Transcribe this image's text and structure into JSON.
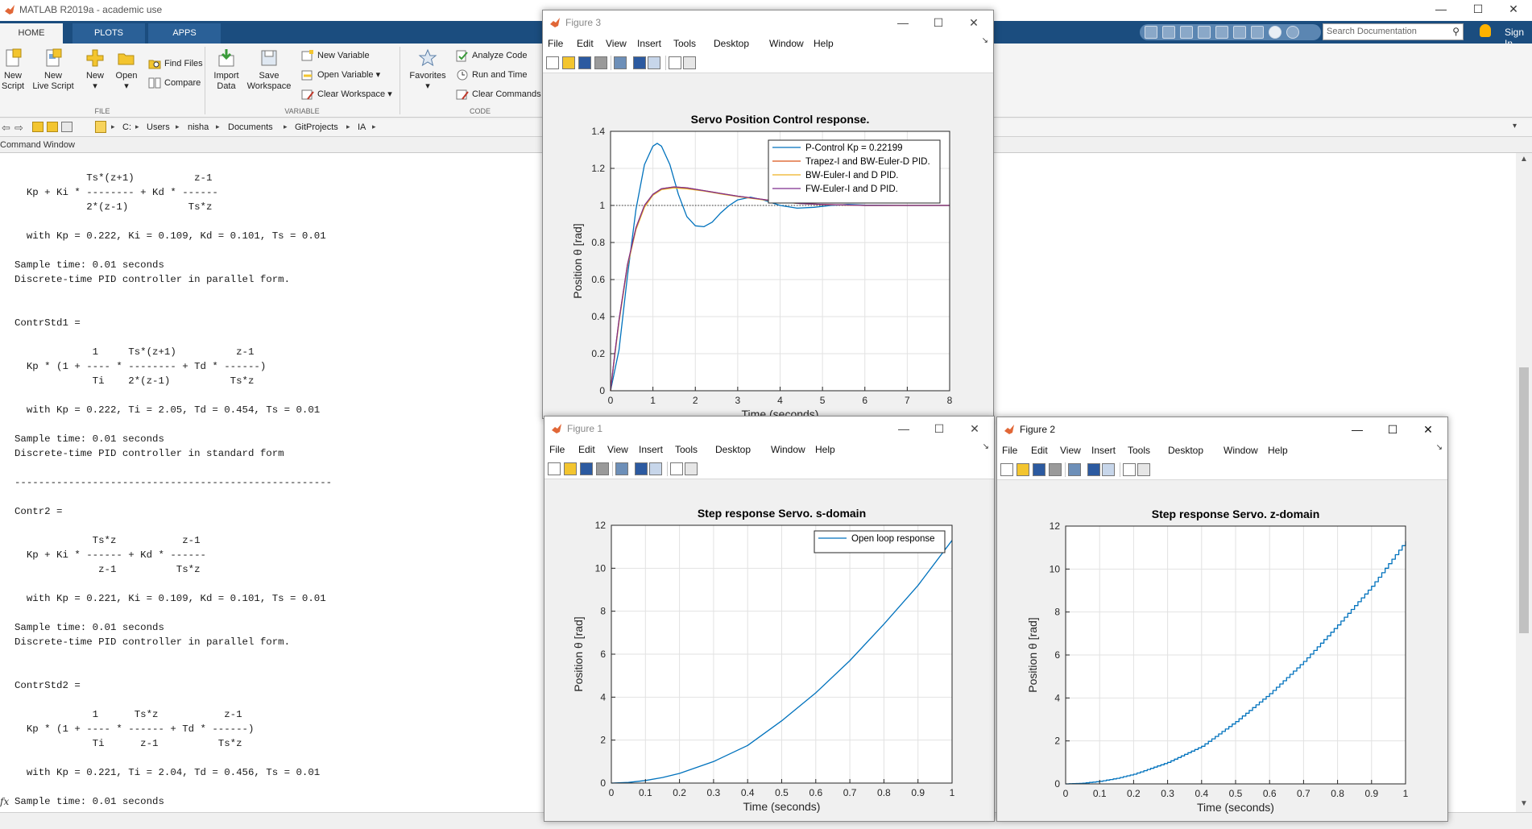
{
  "window": {
    "title": "MATLAB R2019a - academic use",
    "minimize": "—",
    "maximize": "☐",
    "close": "✕"
  },
  "tabs": [
    "HOME",
    "PLOTS",
    "APPS"
  ],
  "search": {
    "placeholder": "Search Documentation"
  },
  "signin": "Sign In",
  "ribbon": {
    "new_script": [
      "New",
      "Script"
    ],
    "new_live_script": [
      "New",
      "Live Script"
    ],
    "new": "New",
    "open": "Open",
    "find_files": "Find Files",
    "compare": "Compare",
    "import_data": [
      "Import",
      "Data"
    ],
    "save_workspace": [
      "Save",
      "Workspace"
    ],
    "new_variable": "New Variable",
    "open_variable": "Open Variable",
    "clear_workspace": "Clear Workspace",
    "favorites": "Favorites",
    "analyze_code": "Analyze Code",
    "run_and_time": "Run and Time",
    "clear_commands": "Clear Commands",
    "sections": [
      "FILE",
      "VARIABLE",
      "CODE"
    ]
  },
  "path": [
    "C:",
    "Users",
    "nisha",
    "Documents",
    "GitProjects",
    "IA"
  ],
  "command_window": {
    "title": "Command Window",
    "prompt_icon": "fx",
    "lines": [
      "            Ts*(z+1)          z-1",
      "  Kp + Ki * -------- + Kd * ------",
      "            2*(z-1)          Ts*z",
      "",
      "  with Kp = 0.222, Ki = 0.109, Kd = 0.101, Ts = 0.01",
      "",
      "Sample time: 0.01 seconds",
      "Discrete-time PID controller in parallel form.",
      "",
      "",
      "ContrStd1 =",
      "",
      "             1     Ts*(z+1)          z-1",
      "  Kp * (1 + ---- * -------- + Td * ------)",
      "             Ti    2*(z-1)          Ts*z",
      "",
      "  with Kp = 0.222, Ti = 2.05, Td = 0.454, Ts = 0.01",
      "",
      "Sample time: 0.01 seconds",
      "Discrete-time PID controller in standard form",
      "",
      "-----------------------------------------------------",
      "",
      "Contr2 =",
      "",
      "             Ts*z           z-1",
      "  Kp + Ki * ------ + Kd * ------",
      "              z-1          Ts*z",
      "",
      "  with Kp = 0.221, Ki = 0.109, Kd = 0.101, Ts = 0.01",
      "",
      "Sample time: 0.01 seconds",
      "Discrete-time PID controller in parallel form.",
      "",
      "",
      "ContrStd2 =",
      "",
      "             1      Ts*z           z-1",
      "  Kp * (1 + ---- * ------ + Td * ------)",
      "             Ti      z-1          Ts*z",
      "",
      "  with Kp = 0.221, Ti = 2.04, Td = 0.456, Ts = 0.01",
      "",
      "Sample time: 0.01 seconds"
    ]
  },
  "figure_menu": [
    "File",
    "Edit",
    "View",
    "Insert",
    "Tools",
    "Desktop",
    "Window",
    "Help"
  ],
  "figures": [
    {
      "id": "fig3",
      "title": "Figure 3",
      "title_active": false
    },
    {
      "id": "fig1",
      "title": "Figure 1",
      "title_active": false
    },
    {
      "id": "fig2",
      "title": "Figure 2",
      "title_active": true
    }
  ],
  "chart_data": [
    {
      "figure": "Figure 3",
      "type": "line",
      "title": "Servo Position Control response.",
      "xlabel": "Time (seconds)",
      "ylabel": "Position θ [rad]",
      "xlim": [
        0,
        8
      ],
      "ylim": [
        0,
        1.4
      ],
      "xticks": [
        0,
        1,
        2,
        3,
        4,
        5,
        6,
        7,
        8
      ],
      "yticks": [
        0,
        0.2,
        0.4,
        0.6,
        0.8,
        1,
        1.2,
        1.4
      ],
      "grid": true,
      "legend_position": "top-right",
      "reference_line": {
        "y": 1,
        "style": "dotted",
        "color": "#333333"
      },
      "series": [
        {
          "name": "P-Control Kp = 0.22199",
          "color": "#0072bd",
          "x": [
            0,
            0.2,
            0.4,
            0.6,
            0.8,
            1.0,
            1.1,
            1.2,
            1.4,
            1.6,
            1.8,
            2.0,
            2.2,
            2.4,
            2.6,
            2.8,
            3.0,
            3.3,
            3.6,
            4.0,
            4.4,
            4.8,
            5.2,
            5.6,
            6.0,
            7.0,
            8.0
          ],
          "y": [
            0,
            0.22,
            0.62,
            0.98,
            1.22,
            1.32,
            1.335,
            1.32,
            1.22,
            1.06,
            0.94,
            0.89,
            0.885,
            0.91,
            0.96,
            1.0,
            1.03,
            1.045,
            1.03,
            1.0,
            0.985,
            0.99,
            1.0,
            1.005,
            1.002,
            1.0,
            1.0
          ]
        },
        {
          "name": "Trapez-I and BW-Euler-D PID.",
          "color": "#d95319",
          "x": [
            0,
            0.1,
            0.2,
            0.4,
            0.6,
            0.8,
            1.0,
            1.2,
            1.5,
            1.8,
            2.2,
            2.6,
            3.0,
            3.5,
            4.0,
            4.5,
            5.0,
            6.0,
            7.0,
            8.0
          ],
          "y": [
            0,
            0.2,
            0.38,
            0.68,
            0.88,
            1.0,
            1.06,
            1.09,
            1.1,
            1.095,
            1.08,
            1.065,
            1.05,
            1.035,
            1.02,
            1.01,
            1.005,
            1.0,
            1.0,
            1.0
          ]
        },
        {
          "name": "BW-Euler-I and D PID.",
          "color": "#edb120",
          "x": [
            0,
            0.1,
            0.2,
            0.4,
            0.6,
            0.8,
            1.0,
            1.2,
            1.5,
            1.8,
            2.2,
            2.6,
            3.0,
            3.5,
            4.0,
            4.5,
            5.0,
            6.0,
            7.0,
            8.0
          ],
          "y": [
            0,
            0.19,
            0.37,
            0.67,
            0.87,
            0.99,
            1.055,
            1.085,
            1.095,
            1.09,
            1.078,
            1.062,
            1.048,
            1.033,
            1.019,
            1.01,
            1.004,
            1.0,
            1.0,
            1.0
          ]
        },
        {
          "name": "FW-Euler-I and D PID.",
          "color": "#7e2f8e",
          "x": [
            0,
            0.1,
            0.2,
            0.4,
            0.6,
            0.8,
            1.0,
            1.2,
            1.5,
            1.8,
            2.2,
            2.6,
            3.0,
            3.5,
            4.0,
            4.5,
            5.0,
            6.0,
            7.0,
            8.0
          ],
          "y": [
            0,
            0.2,
            0.38,
            0.68,
            0.88,
            1.0,
            1.06,
            1.09,
            1.1,
            1.095,
            1.08,
            1.065,
            1.05,
            1.035,
            1.02,
            1.01,
            1.005,
            1.0,
            1.0,
            1.0
          ]
        }
      ]
    },
    {
      "figure": "Figure 1",
      "type": "line",
      "title": "Step response Servo. s-domain",
      "xlabel": "Time (seconds)",
      "ylabel": "Position θ [rad]",
      "xlim": [
        0,
        1
      ],
      "ylim": [
        0,
        12
      ],
      "xticks": [
        0,
        0.1,
        0.2,
        0.3,
        0.4,
        0.5,
        0.6,
        0.7,
        0.8,
        0.9,
        1
      ],
      "yticks": [
        0,
        2,
        4,
        6,
        8,
        10,
        12
      ],
      "grid": true,
      "legend_position": "top-right",
      "series": [
        {
          "name": "Open loop response",
          "color": "#0072bd",
          "x": [
            0,
            0.05,
            0.1,
            0.15,
            0.2,
            0.3,
            0.4,
            0.5,
            0.6,
            0.7,
            0.8,
            0.9,
            1.0
          ],
          "y": [
            0,
            0.03,
            0.12,
            0.26,
            0.45,
            1.0,
            1.75,
            2.9,
            4.2,
            5.7,
            7.4,
            9.2,
            11.3
          ]
        }
      ]
    },
    {
      "figure": "Figure 2",
      "type": "line",
      "title": "Step response Servo. z-domain",
      "xlabel": "Time (seconds)",
      "ylabel": "Position θ [rad]",
      "xlim": [
        0,
        1
      ],
      "ylim": [
        0,
        12
      ],
      "xticks": [
        0,
        0.1,
        0.2,
        0.3,
        0.4,
        0.5,
        0.6,
        0.7,
        0.8,
        0.9,
        1
      ],
      "yticks": [
        0,
        2,
        4,
        6,
        8,
        10,
        12
      ],
      "grid": true,
      "legend_position": "none",
      "step": true,
      "series": [
        {
          "name": "",
          "color": "#0072bd",
          "x": [
            0,
            0.05,
            0.1,
            0.15,
            0.2,
            0.3,
            0.4,
            0.5,
            0.6,
            0.7,
            0.8,
            0.9,
            1.0
          ],
          "y": [
            0,
            0.03,
            0.12,
            0.26,
            0.45,
            1.0,
            1.75,
            2.9,
            4.2,
            5.7,
            7.4,
            9.2,
            11.3
          ]
        }
      ]
    }
  ]
}
